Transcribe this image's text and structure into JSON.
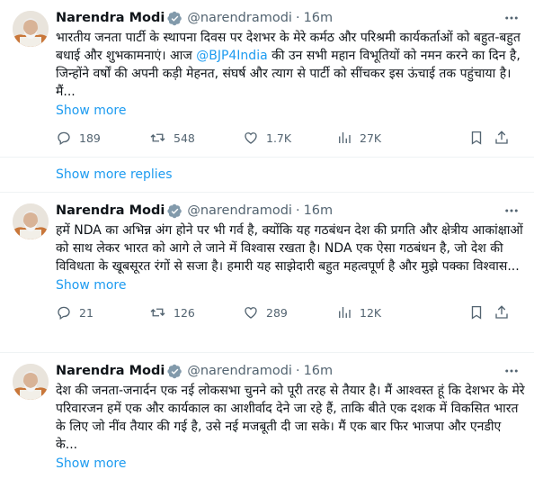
{
  "tweets": [
    {
      "author": {
        "name": "Narendra Modi",
        "handle": "@narendramodi"
      },
      "dot": "·",
      "time": "16m",
      "text_before": "भारतीय जनता पार्टी के स्थापना दिवस पर देशभर के मेरे कर्मठ और परिश्रमी कार्यकर्ताओं को बहुत-बहुत बधाई और शुभकामनाएं। आज ",
      "mention": "@BJP4India",
      "text_after": " की उन सभी महान विभूतियों को नमन करने का दिन है, जिन्होंने वर्षों की अपनी कड़ी मेहनत, संघर्ष और त्याग से पार्टी को सींचकर इस ऊंचाई तक पहुंचाया है। मैं...",
      "show_more": "Show more",
      "replies": "189",
      "reposts": "548",
      "likes": "1.7K",
      "views": "27K"
    },
    {
      "author": {
        "name": "Narendra Modi",
        "handle": "@narendramodi"
      },
      "dot": "·",
      "time": "16m",
      "text_before": "हमें NDA का अभिन्न अंग होने पर भी गर्व है, क्योंकि यह गठबंधन देश की प्रगति और क्षेत्रीय आकांक्षाओं को साथ लेकर भारत को आगे ले जाने में विश्वास रखता है। NDA एक ऐसा गठबंधन है, जो देश की विविधता के खूबसूरत रंगों से सजा है। हमारी यह साझेदारी बहुत महत्वपूर्ण है और मुझे पक्का विश्वास...",
      "mention": "",
      "text_after": "",
      "show_more": "Show more",
      "replies": "21",
      "reposts": "126",
      "likes": "289",
      "views": "12K"
    },
    {
      "author": {
        "name": "Narendra Modi",
        "handle": "@narendramodi"
      },
      "dot": "·",
      "time": "16m",
      "text_before": "देश की जनता-जनार्दन एक नई लोकसभा चुनने को पूरी तरह से तैयार है। मैं आश्वस्त हूं कि देशभर के मेरे परिवारजन हमें एक और कार्यकाल का आशीर्वाद देने जा रहे हैं, ताकि बीते एक दशक में विकसित भारत के लिए जो नींव तैयार की गई है, उसे नई मजबूती दी जा सके। मैं एक बार फिर भाजपा और एनडीए के...",
      "mention": "",
      "text_after": "",
      "show_more": "Show more"
    }
  ],
  "show_more_replies": "Show more replies",
  "icons": {
    "verified": "verified-badge-icon",
    "more": "more-options-icon",
    "reply": "reply-icon",
    "repost": "repost-icon",
    "like": "like-icon",
    "views": "views-icon",
    "bookmark": "bookmark-icon",
    "share": "share-icon"
  },
  "colors": {
    "accent": "#1d9bf0",
    "muted": "#536471",
    "text": "#0f1419"
  }
}
